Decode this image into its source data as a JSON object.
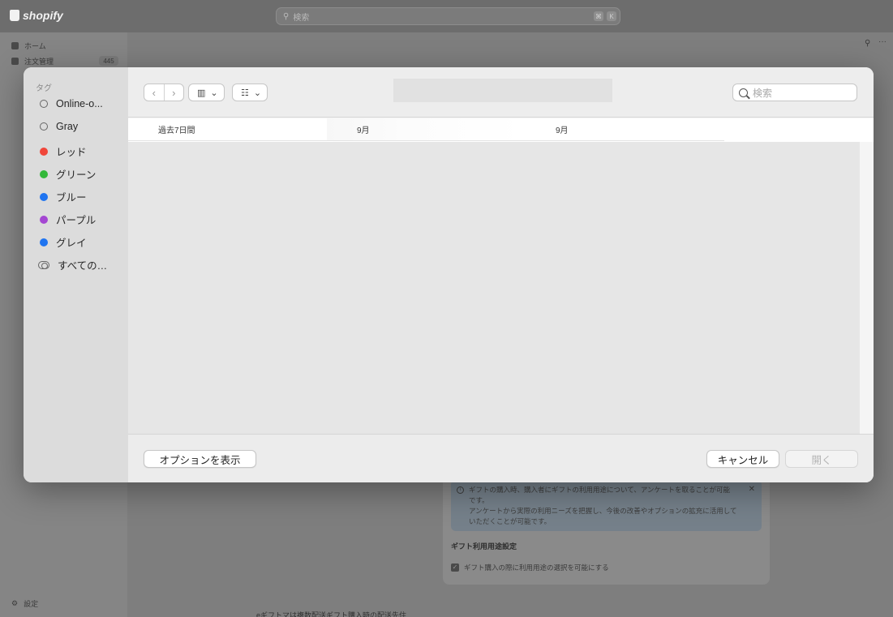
{
  "app": {
    "logo_text": "shopify",
    "search_placeholder": "検索",
    "shortcut_keys": [
      "⌘",
      "K"
    ]
  },
  "sidebar": {
    "items": [
      {
        "label": "ホーム",
        "icon": "home-icon"
      },
      {
        "label": "注文管理",
        "icon": "orders-icon",
        "badge": "445"
      }
    ],
    "settings_label": "設定"
  },
  "background_page": {
    "gift_banner_line1": "ギフトの購入時、購入者にギフトの利用用途について、アンケートを取ることが可能",
    "gift_banner_line2": "です。",
    "gift_banner_line3": "アンケートから実際の利用ニーズを把握し、今後の改善やオプションの拡充に活用して",
    "gift_banner_line4": "いただくことが可能です。",
    "gift_section_heading": "ギフト利用用途設定",
    "gift_checkbox_label": "ギフト購入の際に利用用途の選択を可能にする",
    "gift_bottom_text": "eギフトマは複数配送ギフト購入時の配送先住"
  },
  "dialog": {
    "sidebar_section": "タグ",
    "tags": [
      {
        "label": "Online-o...",
        "color": "outline"
      },
      {
        "label": "Gray",
        "color": "outline"
      },
      {
        "label": "レッド",
        "color": "#f0463a"
      },
      {
        "label": "グリーン",
        "color": "#33b83a"
      },
      {
        "label": "ブルー",
        "color": "#1f74f0"
      },
      {
        "label": "パープル",
        "color": "#a447d2"
      },
      {
        "label": "グレイ",
        "color": "#1f74f0"
      },
      {
        "label": "すべての…",
        "color": "all"
      }
    ],
    "search_placeholder": "検索",
    "columns": [
      "過去7日間",
      "9月",
      "9月"
    ],
    "options_button": "オプションを表示",
    "cancel_button": "キャンセル",
    "open_button": "開く"
  }
}
